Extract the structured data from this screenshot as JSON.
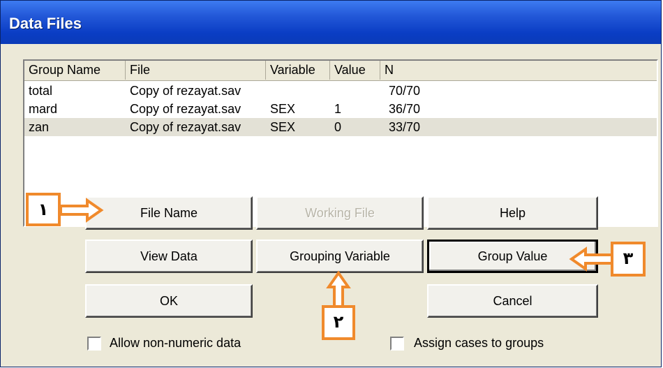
{
  "window": {
    "title": "Data Files"
  },
  "list": {
    "columns": [
      "Group Name",
      "File",
      "Variable",
      "Value",
      "N"
    ],
    "rows": [
      {
        "group": "total",
        "file": "Copy of rezayat.sav",
        "variable": "",
        "value": "",
        "n": "70/70"
      },
      {
        "group": "mard",
        "file": "Copy of rezayat.sav",
        "variable": "SEX",
        "value": "1",
        "n": "36/70"
      },
      {
        "group": "zan",
        "file": "Copy of rezayat.sav",
        "variable": "SEX",
        "value": "0",
        "n": "33/70"
      }
    ]
  },
  "buttons": {
    "file_name": "File Name",
    "working_file": "Working File",
    "help": "Help",
    "view_data": "View Data",
    "grouping_variable": "Grouping Variable",
    "group_value": "Group Value",
    "ok": "OK",
    "cancel": "Cancel"
  },
  "checkboxes": {
    "allow_non_numeric": "Allow non-numeric data",
    "assign_cases": "Assign cases to groups"
  },
  "callouts": {
    "one": "١",
    "two": "٢",
    "three": "٣"
  },
  "colors": {
    "titlebar": "#0a3dc4",
    "dialog_bg": "#ece9d8",
    "callout_border": "#f08a2c"
  }
}
